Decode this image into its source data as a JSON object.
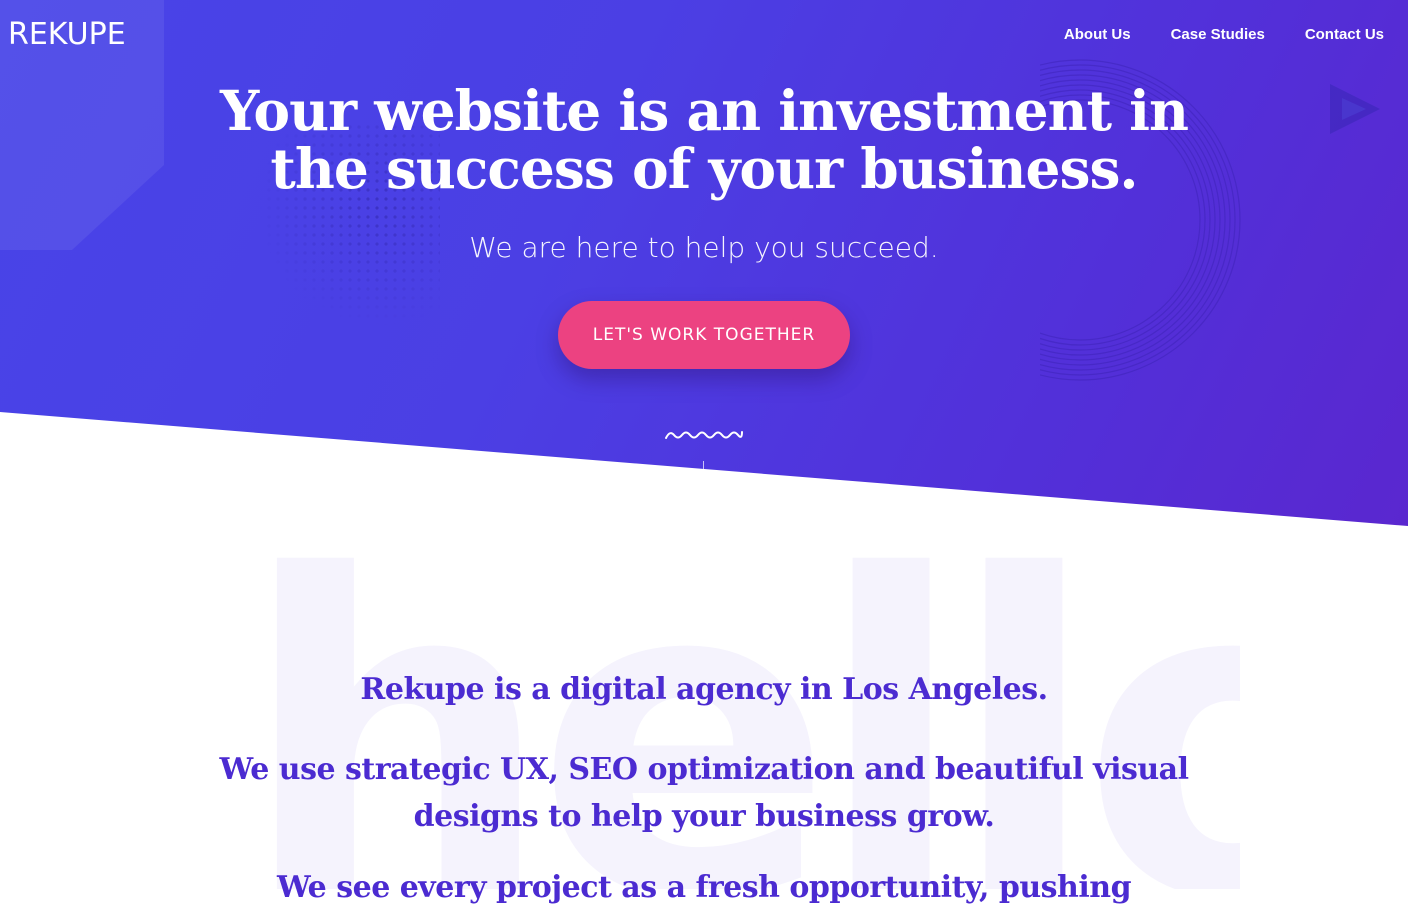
{
  "brand": {
    "logo_text": "REKUPE"
  },
  "nav": {
    "items": [
      "About Us",
      "Case Studies",
      "Contact Us"
    ]
  },
  "hero": {
    "headline_line1": "Your website is an investment in",
    "headline_line2": "the success of your business.",
    "subheadline": "We are here to help you succeed.",
    "cta_label": "LET'S WORK TOGETHER"
  },
  "about": {
    "watermark": "hello",
    "paragraph1": "Rekupe is a digital agency in Los Angeles.",
    "paragraph2_line1": "We use strategic UX, SEO optimization and beautiful visual",
    "paragraph2_line2": "designs to help your business grow.",
    "paragraph3": "We see every project as a fresh opportunity, pushing"
  },
  "colors": {
    "hero_gradient_start": "#4844e8",
    "hero_gradient_end": "#5a27cf",
    "cta": "#ec4281",
    "accent_text": "#4b2bd1"
  },
  "icons": [
    "wave-icon",
    "scroll-indicator",
    "play-icon",
    "dot-pattern",
    "ring-pattern"
  ]
}
